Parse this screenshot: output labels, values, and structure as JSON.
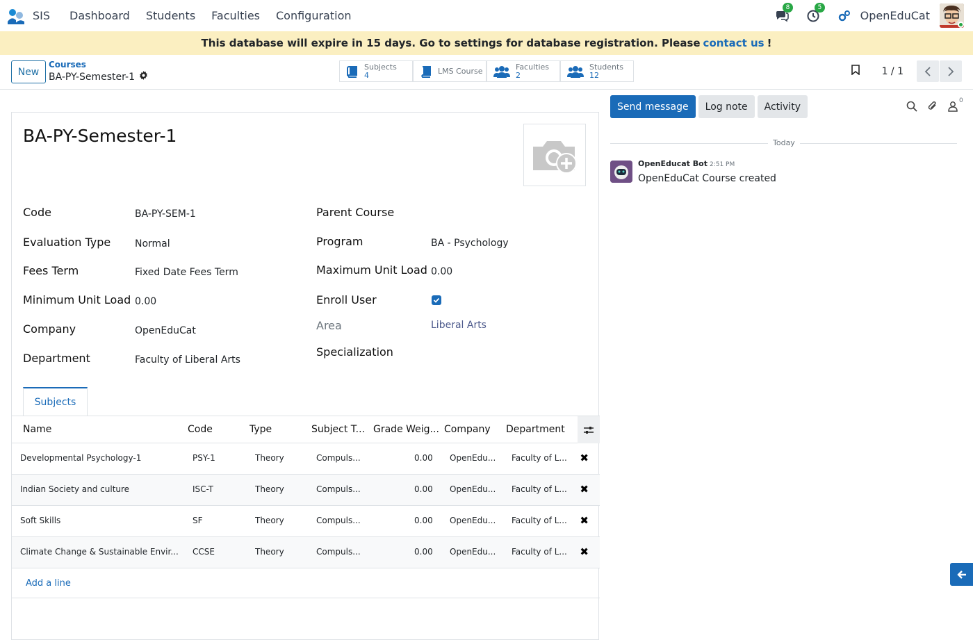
{
  "navbar": {
    "app_name": "SIS",
    "menu": [
      "Dashboard",
      "Students",
      "Faculties",
      "Configuration"
    ],
    "messages_count": "8",
    "activities_count": "5",
    "company": "OpenEduCat"
  },
  "banner": {
    "text_before": "This database will expire in 15 days. Go to settings for database registration. Please",
    "link": "contact us",
    "text_after": "!"
  },
  "control": {
    "new_label": "New",
    "breadcrumb_parent": "Courses",
    "breadcrumb_current": "BA-PY-Semester-1",
    "smart_buttons": [
      {
        "label": "Subjects",
        "value": "4",
        "icon": "book-icon"
      },
      {
        "label": "LMS Course",
        "value": "",
        "icon": "book-icon"
      },
      {
        "label": "Faculties",
        "value": "2",
        "icon": "users-icon"
      },
      {
        "label": "Students",
        "value": "12",
        "icon": "users-icon"
      }
    ],
    "pager": "1 / 1"
  },
  "form": {
    "title": "BA-PY-Semester-1",
    "left_fields": [
      {
        "label": "Code",
        "value": "BA-PY-SEM-1"
      },
      {
        "label": "Evaluation Type",
        "value": "Normal"
      },
      {
        "label": "Fees Term",
        "value": "Fixed Date Fees Term"
      },
      {
        "label": "Minimum Unit Load",
        "value": "0.00"
      },
      {
        "label": "Company",
        "value": "OpenEduCat"
      },
      {
        "label": "Department",
        "value": "Faculty of Liberal Arts"
      }
    ],
    "right_fields": [
      {
        "label": "Parent Course",
        "value": ""
      },
      {
        "label": "Program",
        "value": "BA - Psychology"
      },
      {
        "label": "Maximum Unit Load",
        "value": "0.00"
      },
      {
        "label": "Enroll User",
        "value": ""
      },
      {
        "label": "Area",
        "value": "Liberal Arts"
      },
      {
        "label": "Specialization",
        "value": ""
      }
    ],
    "enroll_user_checked": true,
    "tab_label": "Subjects",
    "table": {
      "headers": [
        "Name",
        "Code",
        "Type",
        "Subject T...",
        "Grade Weig...",
        "Company",
        "Department"
      ],
      "rows": [
        [
          "Developmental Psychology-1",
          "PSY-1",
          "Theory",
          "Compuls...",
          "0.00",
          "OpenEdu...",
          "Faculty of L..."
        ],
        [
          "Indian Society and culture",
          "ISC-T",
          "Theory",
          "Compuls...",
          "0.00",
          "OpenEdu...",
          "Faculty of L..."
        ],
        [
          "Soft Skills",
          "SF",
          "Theory",
          "Compuls...",
          "0.00",
          "OpenEdu...",
          "Faculty of L..."
        ],
        [
          "Climate Change & Sustainable Envir...",
          "CCSE",
          "Theory",
          "Compuls...",
          "0.00",
          "OpenEdu...",
          "Faculty of L..."
        ]
      ],
      "add_line": "Add a line"
    }
  },
  "chatter": {
    "send_message": "Send message",
    "log_note": "Log note",
    "activity": "Activity",
    "followers_count": "0",
    "date_divider": "Today",
    "message": {
      "author": "OpenEducat Bot",
      "time": "2:51 PM",
      "body": "OpenEduCat Course created"
    }
  },
  "colors": {
    "primary": "#1a6bb8",
    "banner": "#fbefc1",
    "badge": "#28a745"
  }
}
